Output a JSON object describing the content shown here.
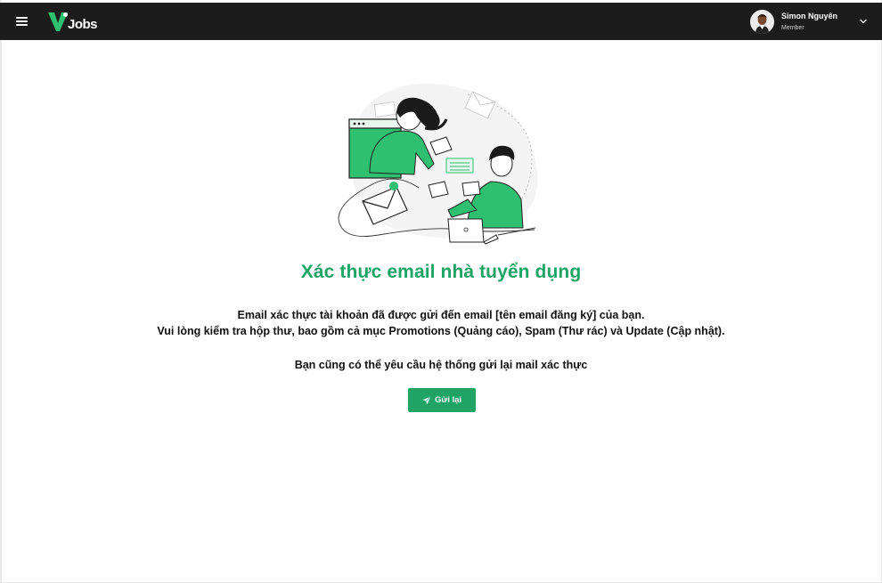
{
  "header": {
    "logo_text": "Jobs",
    "user": {
      "name": "Simon Nguyên",
      "role": "Member"
    }
  },
  "main": {
    "title": "Xác thực email nhà tuyển dụng",
    "description_line1": "Email xác thực tài khoản đã được gửi đến email [tên email đăng ký] của bạn.",
    "description_line2": "Vui lòng kiểm tra hộp thư, bao gồm cả mục Promotions (Quảng cáo), Spam (Thư rác) và Update (Cập nhật).",
    "resend_hint": "Bạn cũng có thể yêu cầu hệ thống gửi lại mail xác thực",
    "resend_button_label": "Gửi lại"
  },
  "colors": {
    "accent": "#1fa466",
    "topbar": "#1c1c1c"
  },
  "icons": {
    "menu": "hamburger-menu-icon",
    "dropdown": "chevron-down-icon",
    "send": "paper-plane-icon"
  }
}
